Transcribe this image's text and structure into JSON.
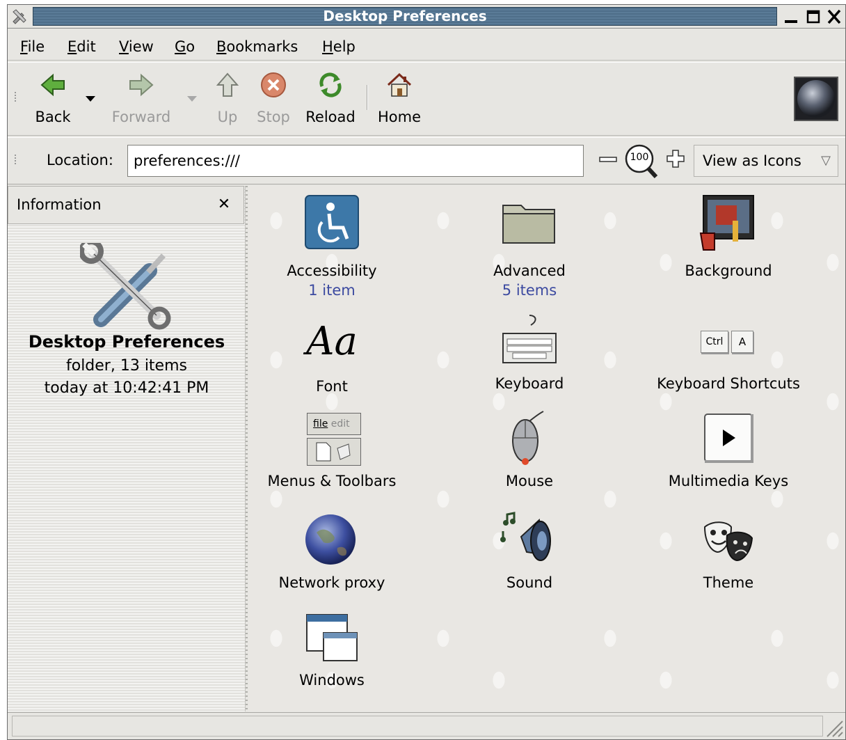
{
  "window": {
    "title": "Desktop Preferences"
  },
  "menubar": {
    "items": [
      {
        "mnemonic": "F",
        "rest": "ile"
      },
      {
        "mnemonic": "E",
        "rest": "dit"
      },
      {
        "mnemonic": "V",
        "rest": "iew"
      },
      {
        "mnemonic": "G",
        "rest": "o"
      },
      {
        "mnemonic": "B",
        "rest": "ookmarks"
      },
      {
        "mnemonic": "H",
        "rest": "elp"
      }
    ]
  },
  "toolbar": {
    "back": "Back",
    "forward": "Forward",
    "up": "Up",
    "stop": "Stop",
    "reload": "Reload",
    "home": "Home"
  },
  "locationbar": {
    "label": "Location:",
    "value": "preferences:///",
    "zoom_level": "100",
    "view_mode": "View as Icons"
  },
  "sidepane": {
    "header": "Information",
    "close_glyph": "✕",
    "folder_name": "Desktop Preferences",
    "folder_info": "folder, 13 items",
    "modified": "today at 10:42:41 PM"
  },
  "icons": [
    {
      "name": "Accessibility",
      "sub": "1 item",
      "icon": "accessibility-icon"
    },
    {
      "name": "Advanced",
      "sub": "5 items",
      "icon": "folder-icon"
    },
    {
      "name": "Background",
      "sub": "",
      "icon": "background-icon"
    },
    {
      "name": "Font",
      "sub": "",
      "icon": "font-icon"
    },
    {
      "name": "Keyboard",
      "sub": "",
      "icon": "keyboard-icon"
    },
    {
      "name": "Keyboard Shortcuts",
      "sub": "",
      "icon": "keyboard-shortcuts-icon"
    },
    {
      "name": "Menus & Toolbars",
      "sub": "",
      "icon": "menus-toolbars-icon"
    },
    {
      "name": "Mouse",
      "sub": "",
      "icon": "mouse-icon"
    },
    {
      "name": "Multimedia Keys",
      "sub": "",
      "icon": "multimedia-keys-icon"
    },
    {
      "name": "Network proxy",
      "sub": "",
      "icon": "network-proxy-icon"
    },
    {
      "name": "Sound",
      "sub": "",
      "icon": "sound-icon"
    },
    {
      "name": "Theme",
      "sub": "",
      "icon": "theme-icon"
    },
    {
      "name": "Windows",
      "sub": "",
      "icon": "windows-icon"
    }
  ],
  "icon_text": {
    "font_glyph": "Aa",
    "ctrl_key": "Ctrl",
    "a_key": "A",
    "menu_file": "file",
    "menu_edit": "edit"
  },
  "colors": {
    "titlebar": "#4f6f8a",
    "sublabel": "#3c4aa0",
    "background": "#e7e6e2"
  }
}
